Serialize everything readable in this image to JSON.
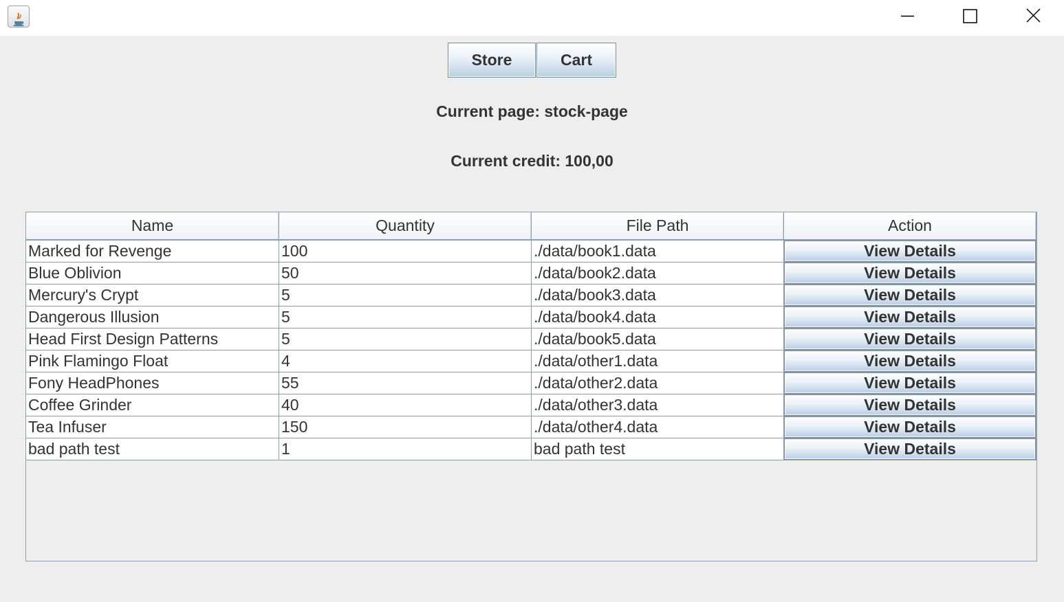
{
  "window": {
    "app_icon": "java-coffee-cup-icon",
    "controls": [
      "minimize-icon",
      "maximize-icon",
      "close-icon"
    ]
  },
  "nav": {
    "store_label": "Store",
    "cart_label": "Cart"
  },
  "info": {
    "current_page": "Current page: stock-page",
    "current_credit": "Current credit: 100,00"
  },
  "table": {
    "headers": [
      "Name",
      "Quantity",
      "File Path",
      "Action"
    ],
    "rows": [
      {
        "name": "Marked for Revenge",
        "quantity": "100",
        "path": "./data/book1.data",
        "action": "View Details"
      },
      {
        "name": "Blue Oblivion",
        "quantity": "50",
        "path": "./data/book2.data",
        "action": "View Details"
      },
      {
        "name": "Mercury's Crypt",
        "quantity": "5",
        "path": "./data/book3.data",
        "action": "View Details"
      },
      {
        "name": "Dangerous Illusion",
        "quantity": "5",
        "path": "./data/book4.data",
        "action": "View Details"
      },
      {
        "name": "Head First Design Patterns",
        "quantity": "5",
        "path": "./data/book5.data",
        "action": "View Details"
      },
      {
        "name": "Pink Flamingo Float",
        "quantity": "4",
        "path": "./data/other1.data",
        "action": "View Details"
      },
      {
        "name": "Fony HeadPhones",
        "quantity": "55",
        "path": "./data/other2.data",
        "action": "View Details"
      },
      {
        "name": "Coffee Grinder",
        "quantity": "40",
        "path": "./data/other3.data",
        "action": "View Details"
      },
      {
        "name": "Tea Infuser",
        "quantity": "150",
        "path": "./data/other4.data",
        "action": "View Details"
      },
      {
        "name": "bad path test",
        "quantity": "1",
        "path": "bad path test",
        "action": "View Details"
      }
    ]
  }
}
